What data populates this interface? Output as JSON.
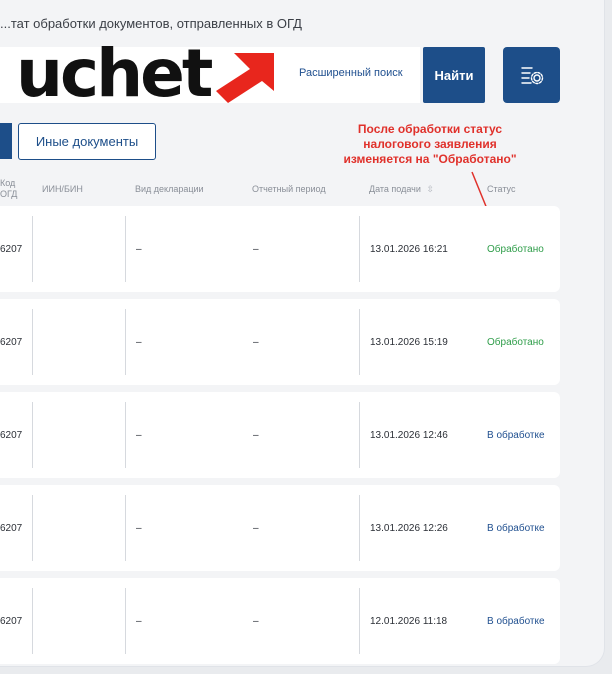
{
  "header": {
    "title": "...тат обработки документов, отправленных в ОГД",
    "logo_text": "uchet",
    "advanced_search": "Расширенный поиск",
    "find_button": "Найти"
  },
  "tabs": {
    "other_documents": "Иные документы"
  },
  "annotation": {
    "line1": "После обработки статус",
    "line2": "налогового заявления",
    "line3": "изменяется на \"Обработано\""
  },
  "table": {
    "columns": {
      "code_line1": "Код",
      "code_line2": "ОГД",
      "iin": "ИИН/БИН",
      "decl_type": "Вид декларации",
      "period": "Отчетный период",
      "date": "Дата подачи",
      "status": "Статус"
    },
    "rows": [
      {
        "code": "6207",
        "iin": "",
        "decl_type": "–",
        "period": "–",
        "date": "13.01.2026 16:21",
        "status": "Обработано",
        "status_kind": "done"
      },
      {
        "code": "6207",
        "iin": "",
        "decl_type": "–",
        "period": "–",
        "date": "13.01.2026 15:19",
        "status": "Обработано",
        "status_kind": "done"
      },
      {
        "code": "6207",
        "iin": "",
        "decl_type": "–",
        "period": "–",
        "date": "13.01.2026 12:46",
        "status": "В обработке",
        "status_kind": "processing"
      },
      {
        "code": "6207",
        "iin": "",
        "decl_type": "–",
        "period": "–",
        "date": "13.01.2026 12:26",
        "status": "В обработке",
        "status_kind": "processing"
      },
      {
        "code": "6207",
        "iin": "",
        "decl_type": "–",
        "period": "–",
        "date": "12.01.2026 11:18",
        "status": "В обработке",
        "status_kind": "processing"
      }
    ]
  },
  "colors": {
    "primary": "#1d4e89",
    "accent_red": "#e0312b",
    "status_done": "#2e9d49",
    "status_processing": "#1f4f8f"
  },
  "icons": {
    "settings": "filter-settings-icon",
    "sort": "sort-arrows-icon",
    "logo_arrow": "arrow-up-right-icon"
  }
}
